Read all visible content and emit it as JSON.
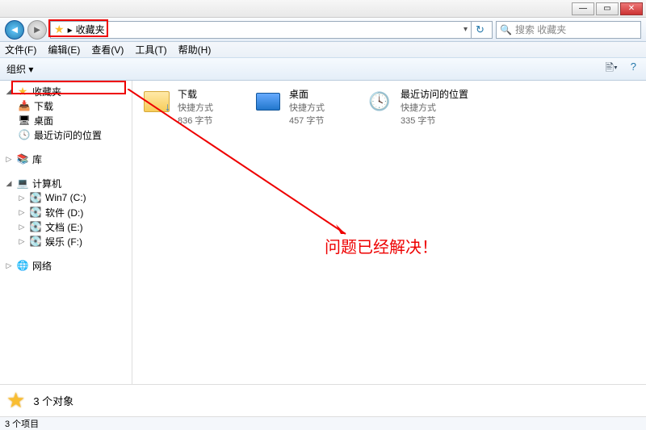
{
  "window": {
    "min": "—",
    "max": "▭",
    "close": "✕"
  },
  "nav": {
    "breadcrumb_item": "收藏夹",
    "search_placeholder": "搜索 收藏夹"
  },
  "menu": {
    "file": "文件(F)",
    "edit": "编辑(E)",
    "view": "查看(V)",
    "tools": "工具(T)",
    "help": "帮助(H)"
  },
  "toolbar": {
    "organize": "组织"
  },
  "sidebar": {
    "favorites": "收藏夹",
    "downloads": "下载",
    "desktop": "桌面",
    "recent": "最近访问的位置",
    "libraries": "库",
    "computer": "计算机",
    "drives": [
      "Win7 (C:)",
      "软件 (D:)",
      "文档 (E:)",
      "娱乐 (F:)"
    ],
    "network": "网络"
  },
  "content": {
    "items": [
      {
        "name": "下载",
        "type": "快捷方式",
        "size": "836 字节"
      },
      {
        "name": "桌面",
        "type": "快捷方式",
        "size": "457 字节"
      },
      {
        "name": "最近访问的位置",
        "type": "快捷方式",
        "size": "335 字节"
      }
    ]
  },
  "status": {
    "objects": "3 个对象",
    "items": "3 个项目"
  },
  "annotation": {
    "text": "问题已经解决！"
  }
}
